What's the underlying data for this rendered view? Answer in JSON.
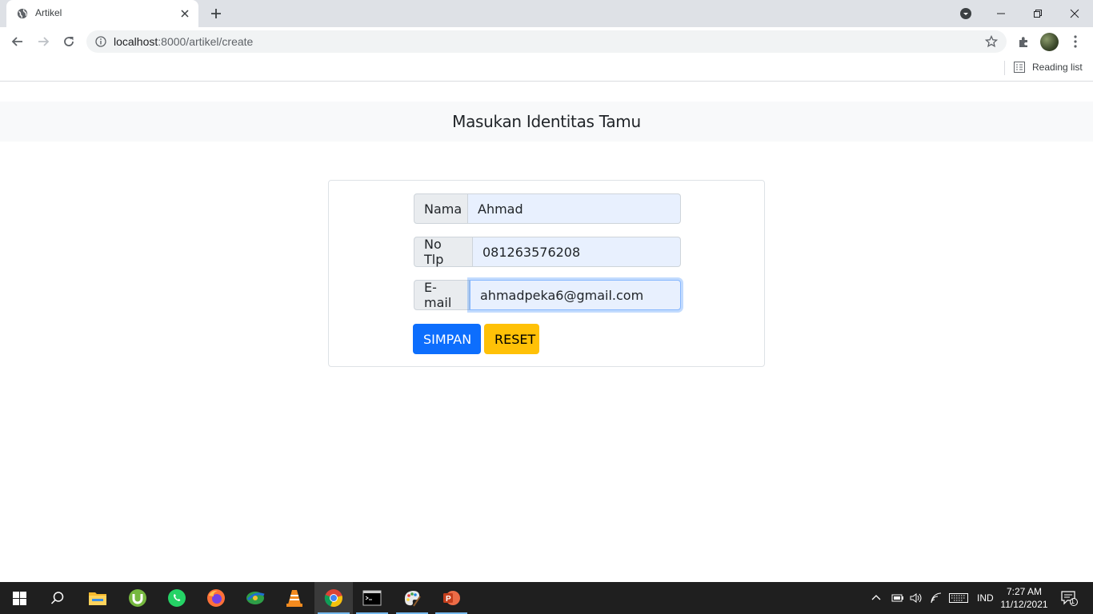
{
  "browser": {
    "tab_title": "Artikel",
    "url_host": "localhost",
    "url_rest": ":8000/artikel/create",
    "reading_list_label": "Reading list"
  },
  "page": {
    "heading": "Masukan Identitas Tamu",
    "form": {
      "nama_label": "Nama",
      "nama_value": "Ahmad",
      "tlp_label": "No Tlp",
      "tlp_value": "081263576208",
      "email_label": "E-mail",
      "email_value": "ahmadpeka6@gmail.com",
      "save_label": "SIMPAN",
      "reset_label": "RESET"
    }
  },
  "taskbar": {
    "apps": [
      "start-icon",
      "search-icon",
      "file-explorer-icon",
      "utorrent-icon",
      "whatsapp-icon",
      "firefox-icon",
      "idm-icon",
      "vlc-icon",
      "chrome-icon",
      "terminal-icon",
      "paint-icon",
      "powerpoint-icon"
    ],
    "lang": "IND",
    "time": "7:27 AM",
    "date": "11/12/2021",
    "notification_count": "1"
  },
  "colors": {
    "primary": "#0d6efd",
    "warning": "#ffc107",
    "autofill": "#e8f0fe"
  }
}
